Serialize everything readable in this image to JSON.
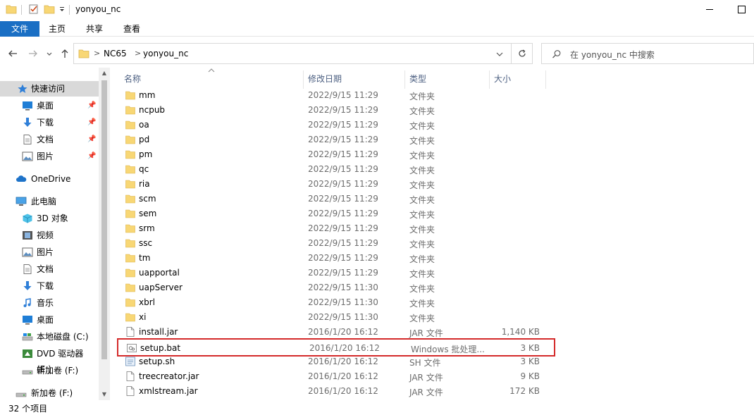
{
  "window": {
    "title": "yonyou_nc"
  },
  "ribbon": {
    "tabs": [
      {
        "label": "文件"
      },
      {
        "label": "主页"
      },
      {
        "label": "共享"
      },
      {
        "label": "查看"
      }
    ]
  },
  "address": {
    "crumbs": [
      "NC65",
      "yonyou_nc"
    ]
  },
  "search": {
    "placeholder": "在 yonyou_nc 中搜索"
  },
  "sidebar": {
    "items": [
      {
        "label": "快速访问",
        "icon": "star-icon",
        "selected": true
      },
      {
        "label": "桌面",
        "icon": "desktop-icon",
        "pinned": true
      },
      {
        "label": "下载",
        "icon": "download-icon",
        "pinned": true
      },
      {
        "label": "文档",
        "icon": "document-icon",
        "pinned": true
      },
      {
        "label": "图片",
        "icon": "picture-icon",
        "pinned": true
      },
      {
        "label": "OneDrive",
        "icon": "cloud-icon"
      },
      {
        "label": "此电脑",
        "icon": "computer-icon"
      },
      {
        "label": "3D 对象",
        "icon": "cube-icon"
      },
      {
        "label": "视频",
        "icon": "video-icon"
      },
      {
        "label": "图片",
        "icon": "picture-icon"
      },
      {
        "label": "文档",
        "icon": "document-icon"
      },
      {
        "label": "下载",
        "icon": "download-icon"
      },
      {
        "label": "音乐",
        "icon": "music-icon"
      },
      {
        "label": "桌面",
        "icon": "desktop-icon"
      },
      {
        "label": "本地磁盘 (C:)",
        "icon": "drive-icon"
      },
      {
        "label": "DVD 驱动器 (E:)",
        "icon": "dvd-icon"
      },
      {
        "label": "新加卷 (F:)",
        "icon": "drive-icon"
      },
      {
        "label": "新加卷 (F:)",
        "icon": "drive-icon"
      }
    ]
  },
  "columns": {
    "name": "名称",
    "date": "修改日期",
    "type": "类型",
    "size": "大小"
  },
  "files": [
    {
      "name": "mm",
      "date": "2022/9/15 11:29",
      "type": "文件夹",
      "size": "",
      "icon": "folder-icon"
    },
    {
      "name": "ncpub",
      "date": "2022/9/15 11:29",
      "type": "文件夹",
      "size": "",
      "icon": "folder-icon"
    },
    {
      "name": "oa",
      "date": "2022/9/15 11:29",
      "type": "文件夹",
      "size": "",
      "icon": "folder-icon"
    },
    {
      "name": "pd",
      "date": "2022/9/15 11:29",
      "type": "文件夹",
      "size": "",
      "icon": "folder-icon"
    },
    {
      "name": "pm",
      "date": "2022/9/15 11:29",
      "type": "文件夹",
      "size": "",
      "icon": "folder-icon"
    },
    {
      "name": "qc",
      "date": "2022/9/15 11:29",
      "type": "文件夹",
      "size": "",
      "icon": "folder-icon"
    },
    {
      "name": "ria",
      "date": "2022/9/15 11:29",
      "type": "文件夹",
      "size": "",
      "icon": "folder-icon"
    },
    {
      "name": "scm",
      "date": "2022/9/15 11:29",
      "type": "文件夹",
      "size": "",
      "icon": "folder-icon"
    },
    {
      "name": "sem",
      "date": "2022/9/15 11:29",
      "type": "文件夹",
      "size": "",
      "icon": "folder-icon"
    },
    {
      "name": "srm",
      "date": "2022/9/15 11:29",
      "type": "文件夹",
      "size": "",
      "icon": "folder-icon"
    },
    {
      "name": "ssc",
      "date": "2022/9/15 11:29",
      "type": "文件夹",
      "size": "",
      "icon": "folder-icon"
    },
    {
      "name": "tm",
      "date": "2022/9/15 11:29",
      "type": "文件夹",
      "size": "",
      "icon": "folder-icon"
    },
    {
      "name": "uapportal",
      "date": "2022/9/15 11:29",
      "type": "文件夹",
      "size": "",
      "icon": "folder-icon"
    },
    {
      "name": "uapServer",
      "date": "2022/9/15 11:30",
      "type": "文件夹",
      "size": "",
      "icon": "folder-icon"
    },
    {
      "name": "xbrl",
      "date": "2022/9/15 11:30",
      "type": "文件夹",
      "size": "",
      "icon": "folder-icon"
    },
    {
      "name": "xi",
      "date": "2022/9/15 11:30",
      "type": "文件夹",
      "size": "",
      "icon": "folder-icon"
    },
    {
      "name": "install.jar",
      "date": "2016/1/20 16:12",
      "type": "JAR 文件",
      "size": "1,140 KB",
      "icon": "file-icon"
    },
    {
      "name": "setup.bat",
      "date": "2016/1/20 16:12",
      "type": "Windows 批处理...",
      "size": "3 KB",
      "icon": "batch-file-icon",
      "highlight": true
    },
    {
      "name": "setup.sh",
      "date": "2016/1/20 16:12",
      "type": "SH 文件",
      "size": "3 KB",
      "icon": "script-file-icon"
    },
    {
      "name": "treecreator.jar",
      "date": "2016/1/20 16:12",
      "type": "JAR 文件",
      "size": "9 KB",
      "icon": "file-icon"
    },
    {
      "name": "xmlstream.jar",
      "date": "2016/1/20 16:12",
      "type": "JAR 文件",
      "size": "172 KB",
      "icon": "file-icon"
    }
  ],
  "status": {
    "item_count": "32 个项目"
  },
  "colors": {
    "accent": "#1a6fc4",
    "folder": "#f8d775",
    "highlight_border": "#d42a2a"
  }
}
